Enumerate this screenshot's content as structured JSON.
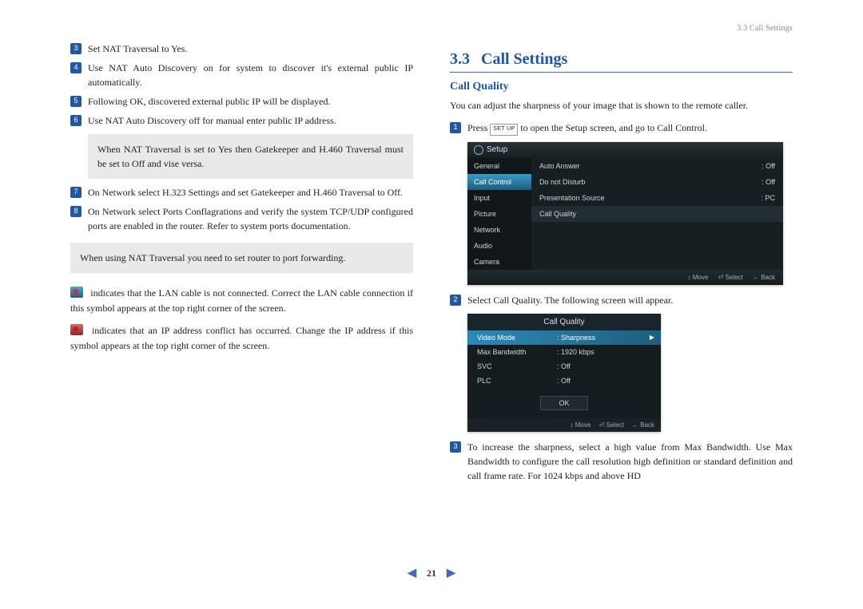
{
  "header": {
    "running": "3.3 Call Settings"
  },
  "left": {
    "items": {
      "3": "Set NAT Traversal to Yes.",
      "4": "Use NAT Auto Discovery on for system to discover it's external public IP automatically.",
      "5": "Following OK, discovered external public IP will be displayed.",
      "6": "Use NAT Auto Discovery off for manual enter public IP address.",
      "7": "On Network select H.323 Settings and set Gatekeeper and H.460 Traversal to Off.",
      "8": "On Network select Ports Conflagrations and verify the system TCP/UDP configured ports are enabled in the router. Refer to system ports documentation."
    },
    "note1": "When NAT Traversal is set to Yes then Gatekeeper and H.460 Traversal must be set to Off and vise versa.",
    "note2": "When using NAT Traversal you need to set router to port forwarding.",
    "info1": "indicates that the LAN cable is not connected. Correct the LAN cable connection if this symbol appears at the top right corner of the screen.",
    "info2": "indicates that an IP address conflict has occurred. Change the IP address if this symbol appears at the top right corner of the screen."
  },
  "right": {
    "secnum": "3.3",
    "secname": "Call Settings",
    "subhead": "Call Quality",
    "intro": "You can adjust the sharpness of your image that is shown to the remote caller.",
    "step1a": "Press ",
    "step1_btn": "SET UP",
    "step1b": " to open the Setup screen, and go to Call Control.",
    "step2": "Select Call Quality. The following screen will appear.",
    "step3": "To increase the sharpness, select a high value from Max Bandwidth. Use Max Bandwidth to configure the call resolution high definition or standard definition and call frame rate. For 1024 kbps and above HD"
  },
  "shot1": {
    "title": "Setup",
    "side": [
      "General",
      "Call Control",
      "Input",
      "Picture",
      "Network",
      "Audio",
      "Camera"
    ],
    "side_active_index": 1,
    "rows": [
      {
        "k": "Auto Answer",
        "v": "Off"
      },
      {
        "k": "Do not Disturb",
        "v": "Off"
      },
      {
        "k": "Presentation Source",
        "v": "PC"
      },
      {
        "k": "Call Quality",
        "v": ""
      }
    ],
    "foot": [
      "↕ Move",
      "⏎ Select",
      "← Back"
    ]
  },
  "shot2": {
    "title": "Call Quality",
    "rows": [
      {
        "k": "Video Mode",
        "v": "Sharpness",
        "active": true
      },
      {
        "k": "Max Bandwidth",
        "v": "1920 kbps"
      },
      {
        "k": "SVC",
        "v": "Off"
      },
      {
        "k": "PLC",
        "v": "Off"
      }
    ],
    "ok": "OK",
    "foot": [
      "↕ Move",
      "⏎ Select",
      "← Back"
    ]
  },
  "footer": {
    "page": "21"
  }
}
